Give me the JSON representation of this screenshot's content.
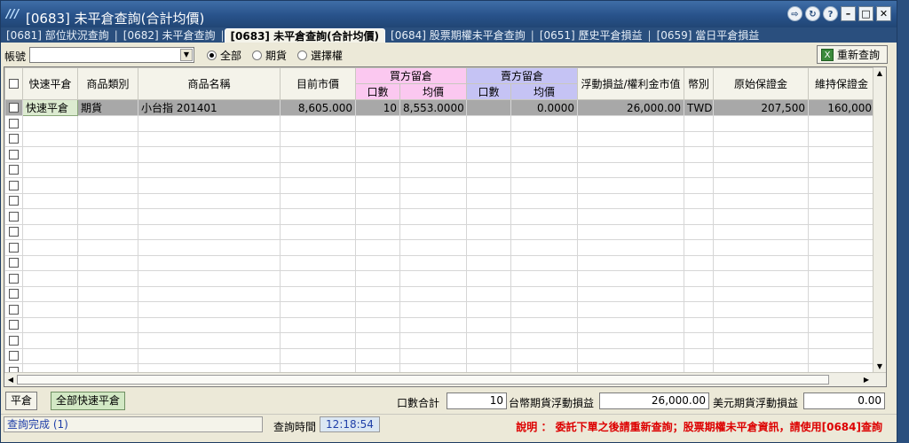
{
  "window": {
    "title": "[0683] 未平倉查詢(合計均價)",
    "logo": "⁄⁄⁄"
  },
  "tabs": [
    {
      "label": "[0681] 部位狀況查詢",
      "active": false
    },
    {
      "label": "[0682] 未平倉查詢",
      "active": false
    },
    {
      "label": "[0683] 未平倉查詢(合計均價)",
      "active": true
    },
    {
      "label": "[0684] 股票期權未平倉查詢",
      "active": false
    },
    {
      "label": "[0651] 歷史平倉損益",
      "active": false
    },
    {
      "label": "[0659] 當日平倉損益",
      "active": false
    }
  ],
  "toolbar": {
    "account_label": "帳號",
    "account_value": "",
    "radios": [
      {
        "label": "全部",
        "checked": true
      },
      {
        "label": "期貨",
        "checked": false
      },
      {
        "label": "選擇權",
        "checked": false
      }
    ],
    "requery_label": "重新查詢"
  },
  "grid": {
    "headers": {
      "quick_close": "快速平倉",
      "category": "商品類別",
      "name": "商品名稱",
      "market_price": "目前市價",
      "buy_group": "買方留倉",
      "buy_qty": "口數",
      "buy_avg": "均價",
      "sell_group": "賣方留倉",
      "sell_qty": "口數",
      "sell_avg": "均價",
      "pnl": "浮動損益/權利金市值",
      "currency": "幣別",
      "initial_margin": "原始保證金",
      "maint_margin": "維持保證金"
    },
    "rows": [
      {
        "quick_close": "快速平倉",
        "category": "期貨",
        "name": "小台指 201401",
        "market_price": "8,605.000",
        "buy_qty": "10",
        "buy_avg": "8,553.0000",
        "sell_qty": "",
        "sell_avg": "0.0000",
        "pnl": "26,000.00",
        "currency": "TWD",
        "initial_margin": "207,500",
        "maint_margin": "160,000"
      }
    ],
    "empty_rows": 17
  },
  "bottom": {
    "close_label": "平倉",
    "close_all_label": "全部快速平倉",
    "qty_total_label": "口數合計",
    "qty_total_value": "10",
    "twd_pnl_label": "台幣期貨浮動損益",
    "twd_pnl_value": "26,000.00",
    "usd_pnl_label": "美元期貨浮動損益",
    "usd_pnl_value": "0.00"
  },
  "status": {
    "message": "查詢完成 (1)",
    "time_label": "查詢時間",
    "time_value": "12:18:54",
    "note": "說明 ： 委託下單之後請重新查詢；股票期權未平倉資訊，請使用[0684]查詢"
  }
}
